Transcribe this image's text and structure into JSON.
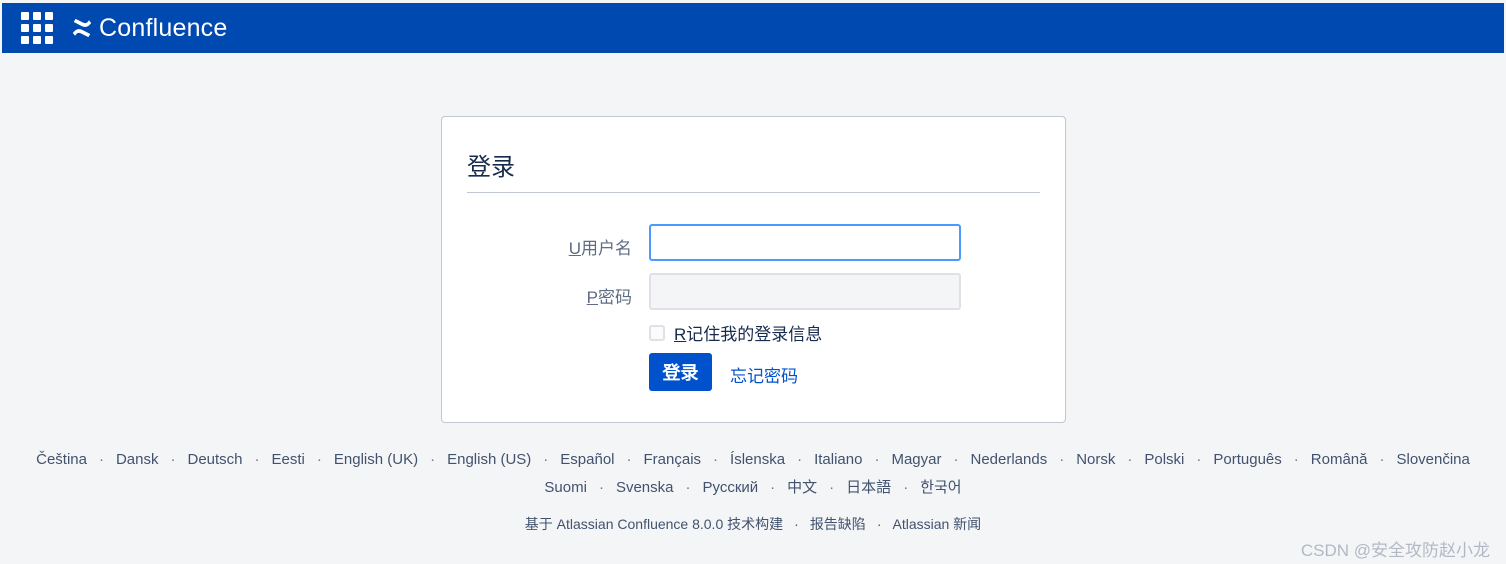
{
  "header": {
    "app_name": "Confluence",
    "app_switcher_icon": "app-grid-icon",
    "logo_icon": "confluence-logo-icon",
    "bg_color": "#0049b0"
  },
  "login": {
    "title": "登录",
    "username_key": "U",
    "username_label": "用户名",
    "username_value": "",
    "password_key": "P",
    "password_label": "密码",
    "password_value": "",
    "remember_key": "R",
    "remember_label": "记住我的登录信息",
    "remember_checked": false,
    "submit_label": "登录",
    "forgot_label": "忘记密码",
    "accent_color": "#0052cc"
  },
  "languages": {
    "row1": [
      "Čeština",
      "Dansk",
      "Deutsch",
      "Eesti",
      "English (UK)",
      "English (US)",
      "Español",
      "Français",
      "Íslenska",
      "Italiano",
      "Magyar",
      "Nederlands",
      "Norsk",
      "Polski",
      "Português",
      "Română",
      "Slovenčina"
    ],
    "row2": [
      "Suomi",
      "Svenska",
      "Русский",
      "中文",
      "日本語",
      "한국어"
    ],
    "separator": "·"
  },
  "footer": {
    "items": [
      "基于 Atlassian Confluence 8.0.0 技术构建",
      "报告缺陷",
      "Atlassian 新闻"
    ],
    "separator": "·"
  },
  "watermark": "CSDN @安全攻防赵小龙"
}
